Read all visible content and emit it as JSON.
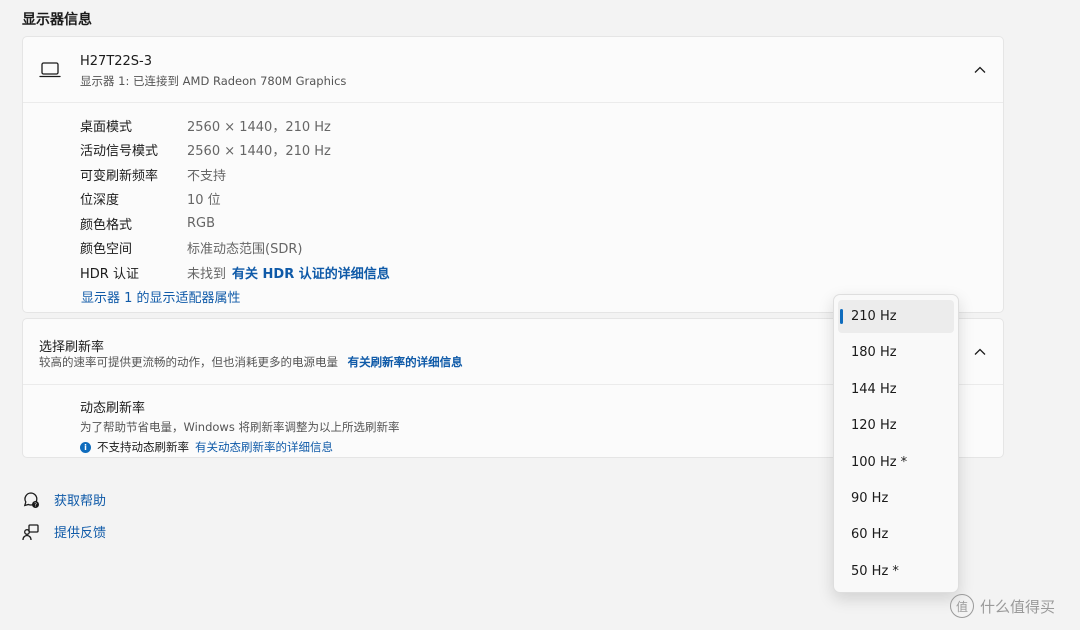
{
  "section_title": "显示器信息",
  "display": {
    "name": "H27T22S-3",
    "subtitle": "显示器 1: 已连接到 AMD Radeon 780M Graphics",
    "properties": [
      {
        "key": "桌面模式",
        "value": "2560 × 1440，210 Hz"
      },
      {
        "key": "活动信号模式",
        "value": "2560 × 1440，210 Hz"
      },
      {
        "key": "可变刷新频率",
        "value": "不支持"
      },
      {
        "key": "位深度",
        "value": "10 位"
      },
      {
        "key": "颜色格式",
        "value": "RGB"
      },
      {
        "key": "颜色空间",
        "value": "标准动态范围(SDR)"
      },
      {
        "key": "HDR 认证",
        "value": "未找到",
        "link": "有关 HDR 认证的详细信息"
      }
    ],
    "adapter_link": "显示器 1 的显示适配器属性"
  },
  "refresh": {
    "title": "选择刷新率",
    "subtitle": "较高的速率可提供更流畅的动作，但也消耗更多的电源电量",
    "subtitle_link": "有关刷新率的详细信息",
    "dynamic_title": "动态刷新率",
    "dynamic_desc": "为了帮助节省电量，Windows 将刷新率调整为以上所选刷新率",
    "dynamic_info": "不支持动态刷新率",
    "dynamic_link": "有关动态刷新率的详细信息"
  },
  "help": {
    "get_help": "获取帮助",
    "feedback": "提供反馈"
  },
  "dropdown": {
    "selected": "210 Hz",
    "options": [
      "210 Hz",
      "180 Hz",
      "144 Hz",
      "120 Hz",
      "100 Hz *",
      "90 Hz",
      "60 Hz",
      "50 Hz *"
    ]
  },
  "watermark": {
    "glyph": "值",
    "text": "什么值得买"
  },
  "colors": {
    "accent": "#0f6cbd",
    "link": "#0f5aa8"
  }
}
